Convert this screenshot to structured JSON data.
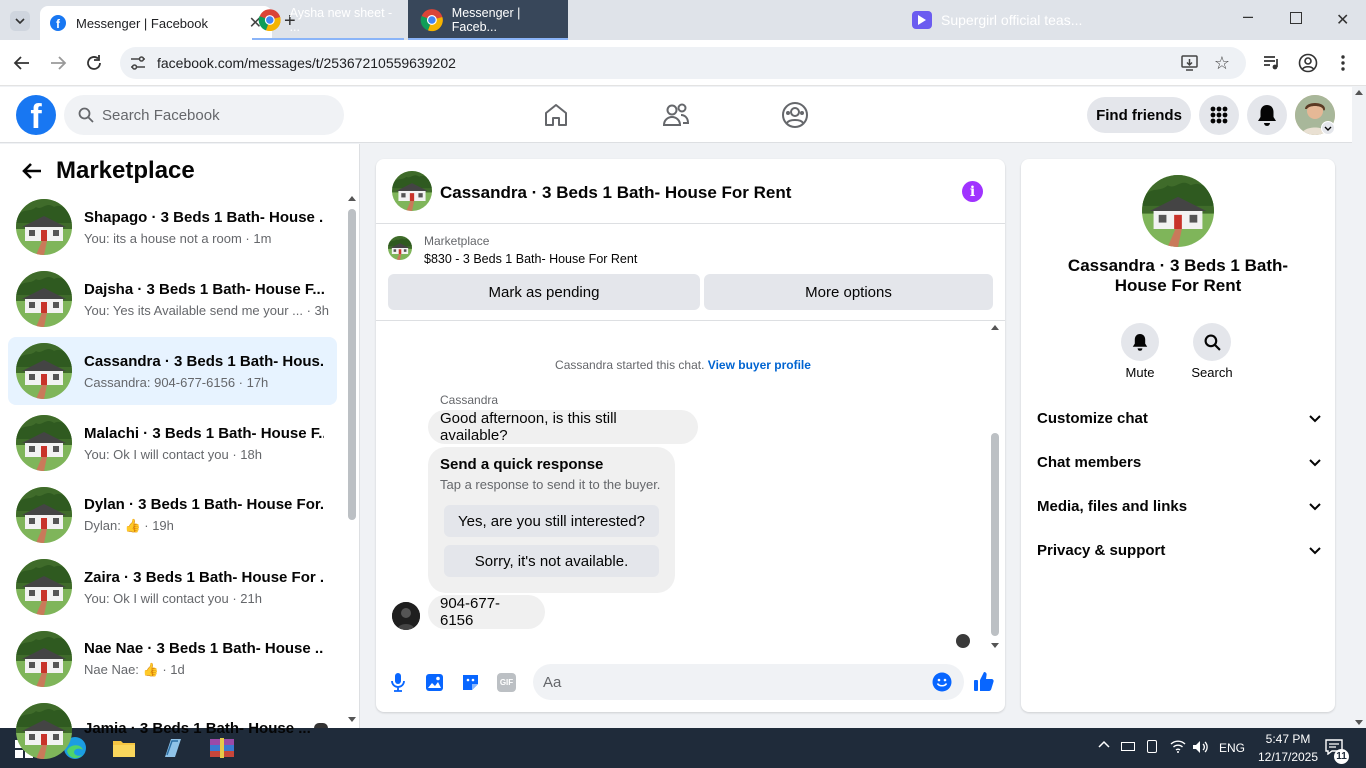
{
  "browser": {
    "tab_title": "Messenger | Facebook",
    "url": "facebook.com/messages/t/25367210559639202"
  },
  "fb_header": {
    "search_placeholder": "Search Facebook",
    "find_friends": "Find friends"
  },
  "marketplace": {
    "title": "Marketplace",
    "conversations": [
      {
        "name": "Shapago · 3 Beds 1 Bath- House ...",
        "preview": "You: its a house not a room · 1m",
        "active": false
      },
      {
        "name": "Dajsha · 3 Beds 1 Bath- House F...",
        "preview": "You: Yes its Available send me your ... · 3h",
        "active": false
      },
      {
        "name": "Cassandra · 3 Beds 1 Bath- Hous...",
        "preview": "Cassandra: 904-677-6156 · 17h",
        "active": true
      },
      {
        "name": "Malachi · 3 Beds 1 Bath- House F...",
        "preview": "You: Ok I will contact you · 18h",
        "active": false
      },
      {
        "name": "Dylan · 3 Beds 1 Bath- House For...",
        "preview": "Dylan: 👍 · 19h",
        "active": false
      },
      {
        "name": "Zaira · 3 Beds 1 Bath- House For ...",
        "preview": "You: Ok I will contact you · 21h",
        "active": false
      },
      {
        "name": "Nae Nae · 3 Beds 1 Bath- House ...",
        "preview": "Nae Nae: 👍 · 1d",
        "active": false
      },
      {
        "name": "Jamia · 3 Beds 1 Bath- House ...",
        "preview": "",
        "active": false
      }
    ]
  },
  "chat": {
    "title": "Cassandra · 3 Beds 1 Bath- House For Rent",
    "listing_source": "Marketplace",
    "listing_price_title": "$830 - 3 Beds 1 Bath- House For Rent",
    "mark_pending": "Mark as pending",
    "more_options": "More options",
    "started_text": "Cassandra started this chat.",
    "view_buyer_profile": "View buyer profile",
    "sender_name": "Cassandra",
    "message1": "Good afternoon, is this still available?",
    "quick_title": "Send a quick response",
    "quick_sub": "Tap a response to send it to the buyer.",
    "quick_reply1": "Yes, are you still interested?",
    "quick_reply2": "Sorry, it's not available.",
    "message2": "904-677-6156",
    "composer_placeholder": "Aa"
  },
  "info_panel": {
    "title": "Cassandra · 3 Beds 1 Bath- House For Rent",
    "mute": "Mute",
    "search": "Search",
    "sections": [
      "Customize chat",
      "Chat members",
      "Media, files and links",
      "Privacy & support"
    ]
  },
  "taskbar": {
    "app1": "Aysha new sheet - ...",
    "app2": "Messenger | Faceb...",
    "media": "Supergirl official teas...",
    "lang": "ENG",
    "time": "5:47 PM",
    "date": "12/17/2025",
    "notif_count": "11"
  },
  "colors": {
    "fb_blue": "#1877f2",
    "active_conv": "#e7f3ff",
    "info_purple": "#a033ff"
  }
}
